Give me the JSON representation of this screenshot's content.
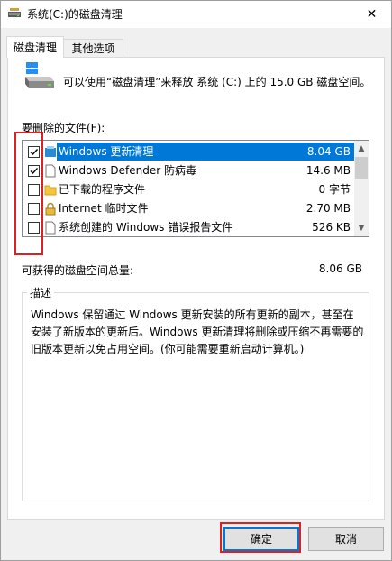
{
  "window": {
    "title": "系统(C:)的磁盘清理",
    "close_label": "✕"
  },
  "tabs": [
    {
      "label": "磁盘清理",
      "active": true
    },
    {
      "label": "其他选项",
      "active": false
    }
  ],
  "intro_text": "可以使用“磁盘清理”来释放 系统 (C:) 上的 15.0 GB 磁盘空间。",
  "files_label": "要删除的文件(F):",
  "files": [
    {
      "name": "Windows 更新清理",
      "size": "8.04 GB",
      "checked": true,
      "selected": true,
      "icon": "windows-update-icon"
    },
    {
      "name": "Windows Defender 防病毒",
      "size": "14.6 MB",
      "checked": true,
      "selected": false,
      "icon": "document-icon"
    },
    {
      "name": "已下载的程序文件",
      "size": "0 字节",
      "checked": false,
      "selected": false,
      "icon": "folder-icon"
    },
    {
      "name": "Internet 临时文件",
      "size": "2.70 MB",
      "checked": false,
      "selected": false,
      "icon": "lock-icon"
    },
    {
      "name": "系统创建的 Windows 错误报告文件",
      "size": "526 KB",
      "checked": false,
      "selected": false,
      "icon": "document-icon"
    }
  ],
  "space": {
    "label": "可获得的磁盘空间总量:",
    "value": "8.06 GB"
  },
  "description": {
    "title": "描述",
    "text": "Windows 保留通过 Windows 更新安装的所有更新的副本，甚至在安装了新版本的更新后。Windows 更新清理将删除或压缩不再需要的旧版本更新以免占用空间。(你可能需要重新启动计算机。)"
  },
  "buttons": {
    "ok_label": "确定",
    "cancel_label": "取消"
  },
  "colors": {
    "selection": "#0078d7",
    "highlight_annotation": "#e02020"
  }
}
